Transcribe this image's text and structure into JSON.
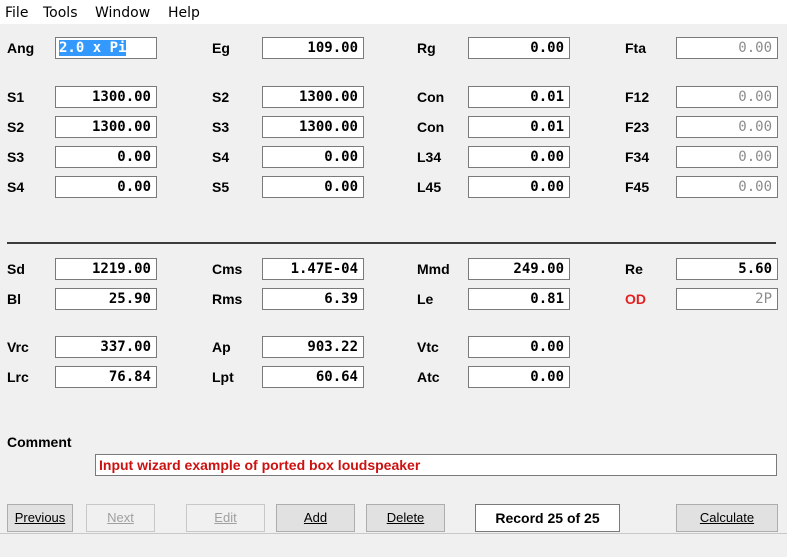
{
  "menu": [
    "File",
    "Tools",
    "Window",
    "Help"
  ],
  "rows": [
    {
      "top": 0,
      "cells": [
        {
          "label": "Ang",
          "value": "2.0 x Pi",
          "selected": true
        },
        {
          "label": "Eg",
          "value": "109.00"
        },
        {
          "label": "Rg",
          "value": "0.00"
        },
        {
          "label": "Fta",
          "value": "0.00",
          "readonly": true
        }
      ]
    },
    {
      "cells": [
        {
          "label": "S1",
          "value": "1300.00"
        },
        {
          "label": "S2",
          "value": "1300.00"
        },
        {
          "label": "Con",
          "value": "0.01"
        },
        {
          "label": "F12",
          "value": "0.00",
          "readonly": true
        }
      ]
    },
    {
      "cells": [
        {
          "label": "S2",
          "value": "1300.00"
        },
        {
          "label": "S3",
          "value": "1300.00"
        },
        {
          "label": "Con",
          "value": "0.01"
        },
        {
          "label": "F23",
          "value": "0.00",
          "readonly": true
        }
      ]
    },
    {
      "cells": [
        {
          "label": "S3",
          "value": "0.00"
        },
        {
          "label": "S4",
          "value": "0.00"
        },
        {
          "label": "L34",
          "value": "0.00"
        },
        {
          "label": "F34",
          "value": "0.00",
          "readonly": true
        }
      ]
    },
    {
      "cells": [
        {
          "label": "S4",
          "value": "0.00"
        },
        {
          "label": "S5",
          "value": "0.00"
        },
        {
          "label": "L45",
          "value": "0.00"
        },
        {
          "label": "F45",
          "value": "0.00",
          "readonly": true
        }
      ]
    },
    {
      "cells": [
        {
          "label": "Sd",
          "value": "1219.00"
        },
        {
          "label": "Cms",
          "value": "1.47E-04"
        },
        {
          "label": "Mmd",
          "value": "249.00"
        },
        {
          "label": "Re",
          "value": "5.60"
        }
      ]
    },
    {
      "cells": [
        {
          "label": "Bl",
          "value": "25.90"
        },
        {
          "label": "Rms",
          "value": "6.39"
        },
        {
          "label": "Le",
          "value": "0.81"
        },
        {
          "label": "OD",
          "value": "2P",
          "readonly": true,
          "label_color": "#e32020"
        }
      ]
    },
    {
      "cells": [
        {
          "label": "Vrc",
          "value": "337.00"
        },
        {
          "label": "Ap",
          "value": "903.22"
        },
        {
          "label": "Vtc",
          "value": "0.00"
        }
      ]
    },
    {
      "cells": [
        {
          "label": "Lrc",
          "value": "76.84"
        },
        {
          "label": "Lpt",
          "value": "60.64"
        },
        {
          "label": "Atc",
          "value": "0.00"
        }
      ]
    }
  ],
  "comment": {
    "label": "Comment",
    "value": "Input wizard example of ported box loudspeaker"
  },
  "buttons": {
    "previous": "Previous",
    "next": "Next",
    "edit": "Edit",
    "add": "Add",
    "delete": "Delete",
    "calculate": "Calculate"
  },
  "record": "Record 25 of 25",
  "colors": {
    "od_label": "#e32020",
    "comment_text": "#cc1111",
    "selection": "#3399ff"
  }
}
